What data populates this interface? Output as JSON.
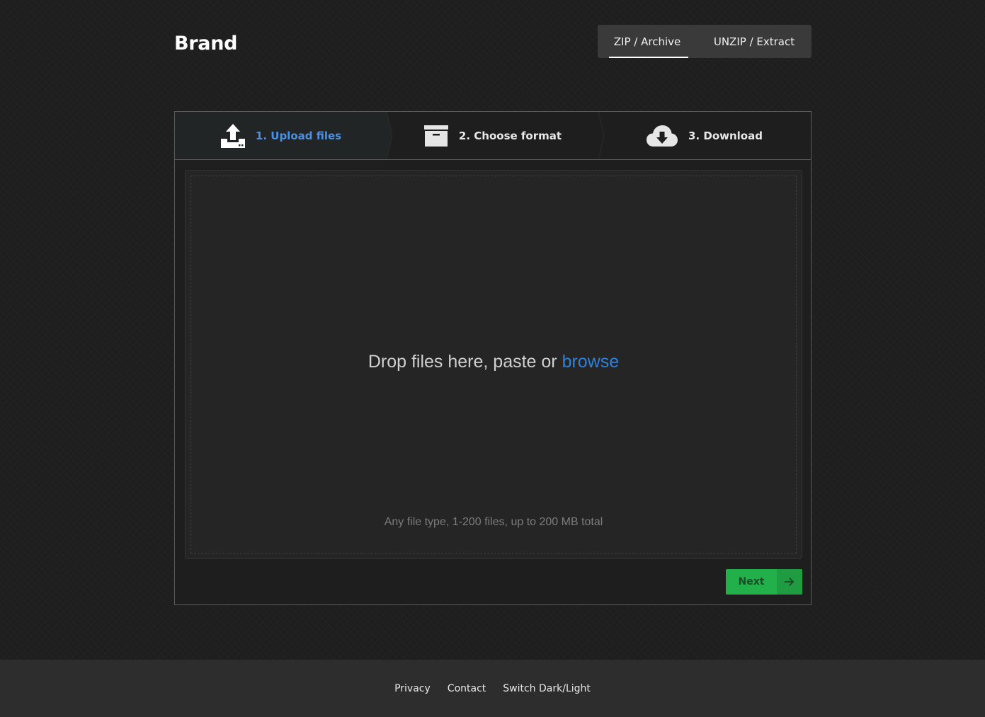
{
  "header": {
    "brand": "Brand",
    "mode_tabs": [
      {
        "label": "ZIP / Archive",
        "active": true
      },
      {
        "label": "UNZIP / Extract",
        "active": false
      }
    ]
  },
  "steps": [
    {
      "label": "1. Upload files",
      "icon": "upload-icon",
      "active": true
    },
    {
      "label": "2. Choose format",
      "icon": "archive-box-icon",
      "active": false
    },
    {
      "label": "3. Download",
      "icon": "cloud-download-icon",
      "active": false
    }
  ],
  "dropzone": {
    "prompt": "Drop files here, paste or ",
    "browse_link": "browse",
    "hint": "Any file type, 1-200 files, up to 200 MB total"
  },
  "actions": {
    "next_label": "Next",
    "next_icon": "arrow-right-icon"
  },
  "footer": {
    "links": [
      "Privacy",
      "Contact",
      "Switch Dark/Light"
    ]
  },
  "colors": {
    "accent": "#4e8fe0",
    "link": "#2f80d8",
    "button": "#22b04a"
  }
}
